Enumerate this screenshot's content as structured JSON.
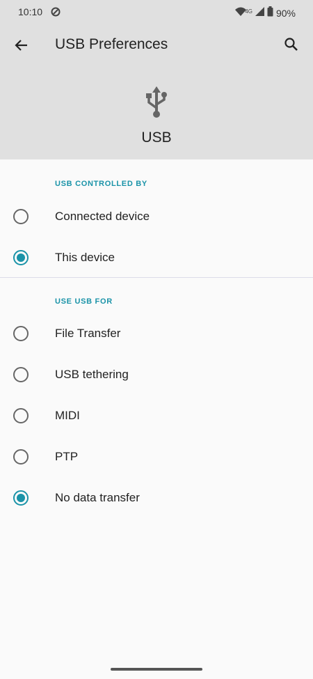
{
  "status_bar": {
    "time": "10:10",
    "network": "4G",
    "battery": "90%"
  },
  "app_bar": {
    "title": "USB Preferences"
  },
  "hero": {
    "label": "USB"
  },
  "sections": [
    {
      "header": "USB CONTROLLED BY",
      "options": [
        {
          "label": "Connected device",
          "selected": false
        },
        {
          "label": "This device",
          "selected": true
        }
      ]
    },
    {
      "header": "USE USB FOR",
      "options": [
        {
          "label": "File Transfer",
          "selected": false
        },
        {
          "label": "USB tethering",
          "selected": false
        },
        {
          "label": "MIDI",
          "selected": false
        },
        {
          "label": "PTP",
          "selected": false
        },
        {
          "label": "No data transfer",
          "selected": true
        }
      ]
    }
  ],
  "colors": {
    "accent": "#1a93a8",
    "header_bg": "#e0e0e0",
    "page_bg": "#fafafa"
  }
}
